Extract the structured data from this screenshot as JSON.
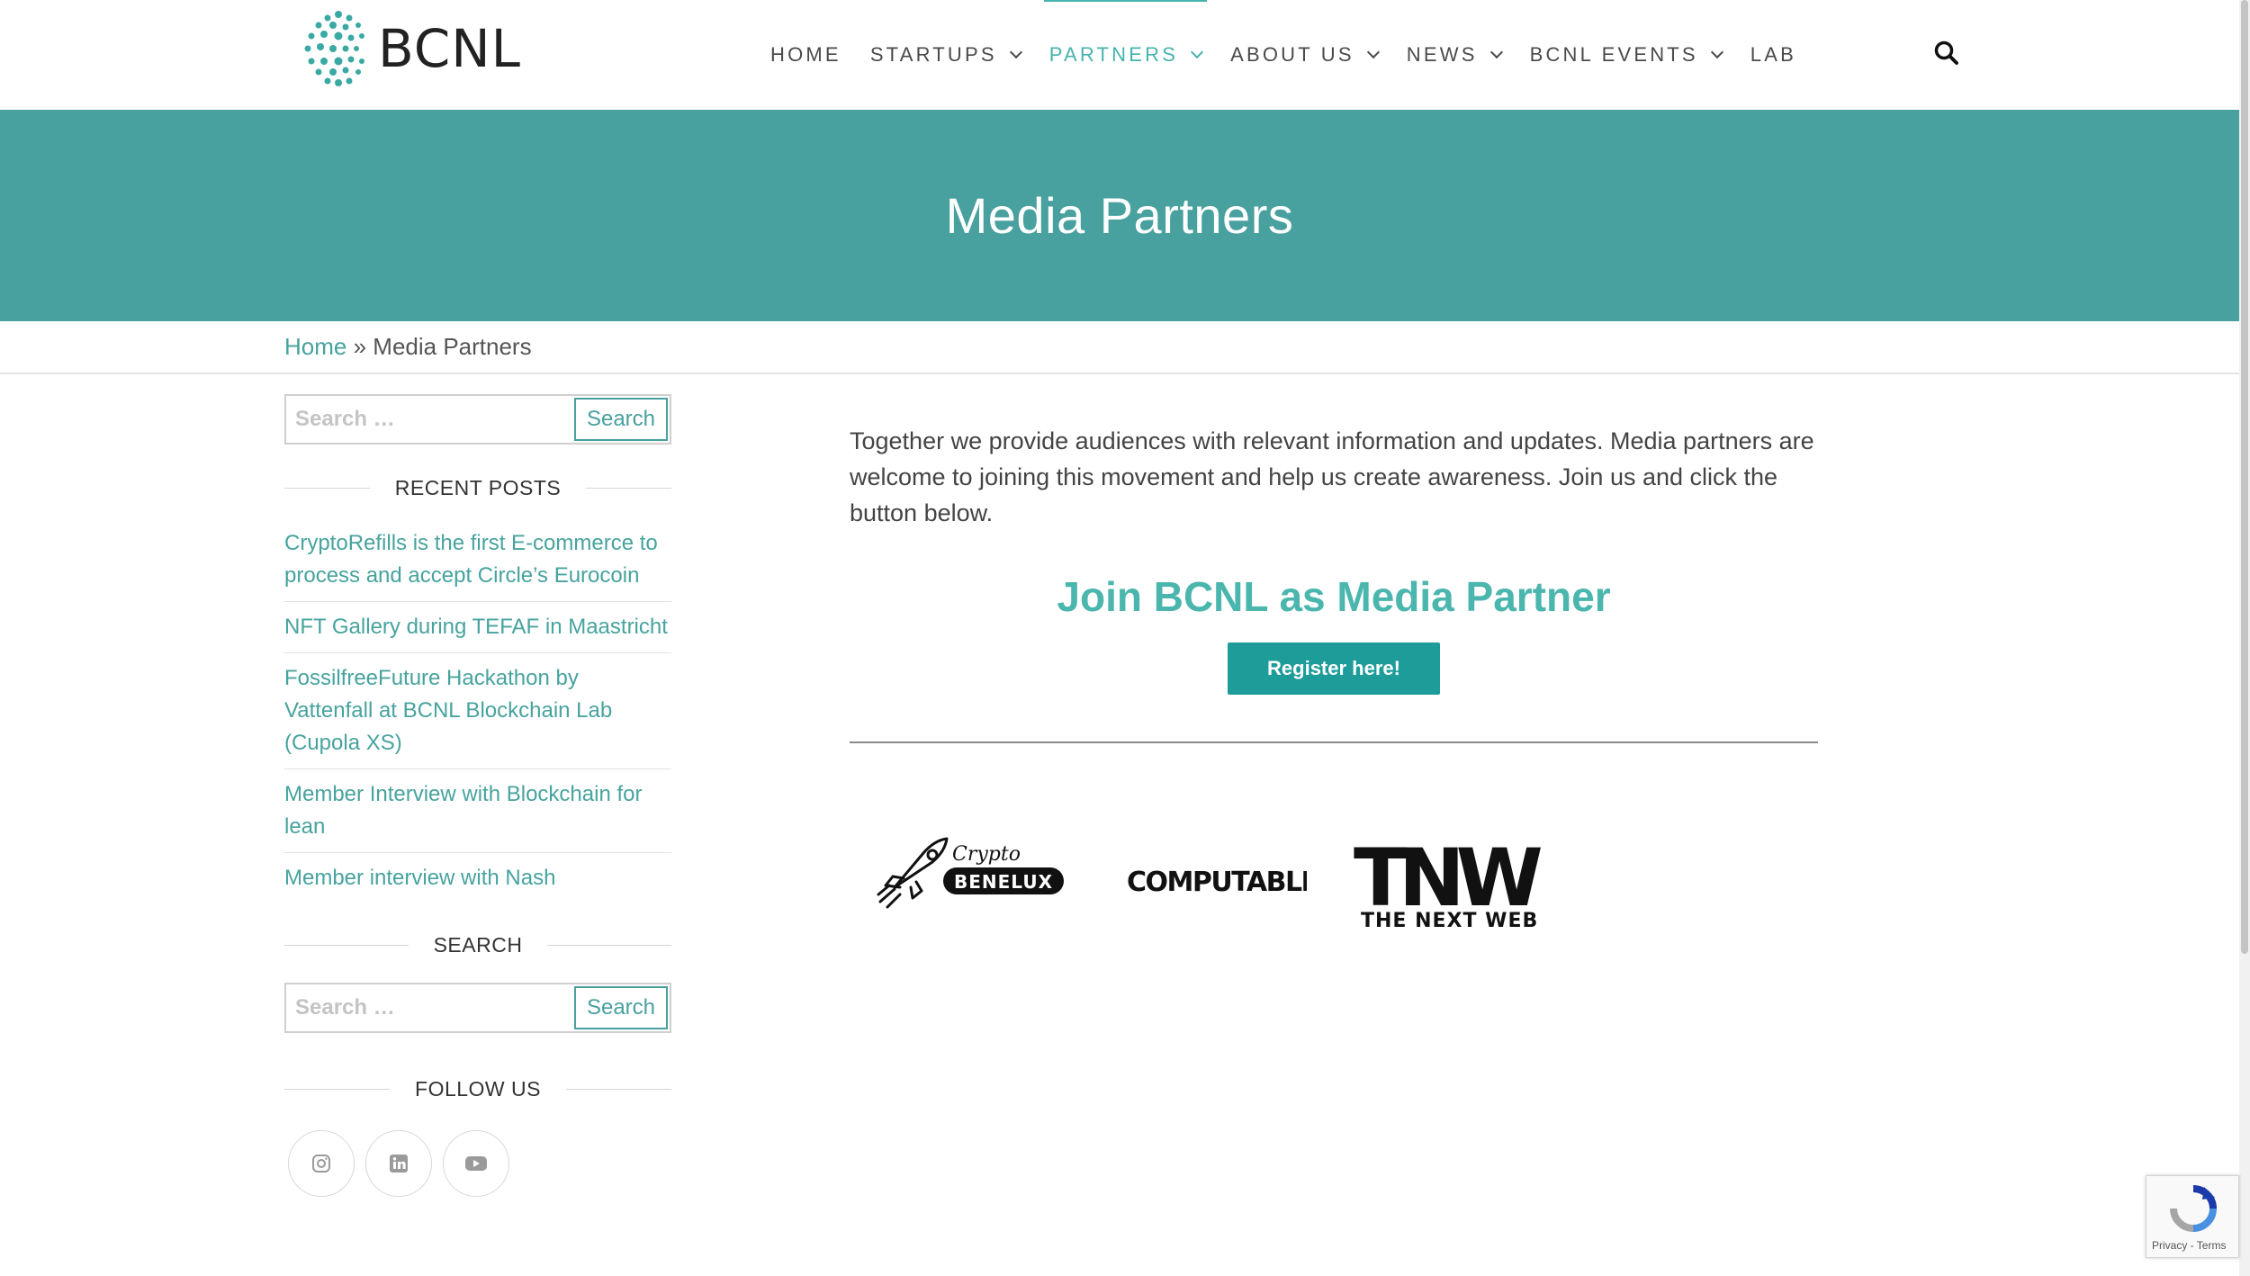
{
  "header": {
    "brand": "BCNL",
    "nav": [
      {
        "label": "HOME",
        "dropdown": false
      },
      {
        "label": "STARTUPS",
        "dropdown": true
      },
      {
        "label": "PARTNERS",
        "dropdown": true,
        "active": true
      },
      {
        "label": "ABOUT US",
        "dropdown": true
      },
      {
        "label": "NEWS",
        "dropdown": true
      },
      {
        "label": "BCNL EVENTS",
        "dropdown": true
      },
      {
        "label": "LAB",
        "dropdown": false
      }
    ],
    "search_icon": "search-icon"
  },
  "hero": {
    "title": "Media Partners"
  },
  "breadcrumb": {
    "home": "Home",
    "separator": " » ",
    "current": "Media Partners"
  },
  "sidebar": {
    "search1": {
      "placeholder": "Search …",
      "button": "Search"
    },
    "recent_title": "RECENT POSTS",
    "recent_posts": [
      "CryptoRefills is the first E-commerce to process and accept Circle’s Eurocoin",
      "NFT Gallery during TEFAF in Maastricht",
      "FossilfreeFuture Hackathon by Vattenfall at BCNL Blockchain Lab (Cupola XS)",
      "Member Interview with Blockchain for lean",
      "Member interview with Nash"
    ],
    "search_title": "SEARCH",
    "search2": {
      "placeholder": "Search …",
      "button": "Search"
    },
    "follow_title": "FOLLOW US",
    "social": [
      "instagram-icon",
      "linkedin-icon",
      "youtube-icon"
    ]
  },
  "main": {
    "intro": "Together we provide audiences with relevant information and updates. Media partners are welcome to joining this movement and help us create awareness. Join us and click the button below.",
    "join_title": "Join BCNL as Media Partner",
    "register_label": "Register here!",
    "partners": [
      {
        "crypto": "Crypto",
        "benelux": "BENELUX"
      },
      {
        "name": "COMPUTABLE"
      },
      {
        "mark": "TNW",
        "name": "THE NEXT WEB"
      }
    ]
  },
  "recaptcha": {
    "text": "Privacy - Terms"
  },
  "colors": {
    "accent": "#47b3ad",
    "hero": "#48a09f",
    "button": "#1d9c9a"
  }
}
